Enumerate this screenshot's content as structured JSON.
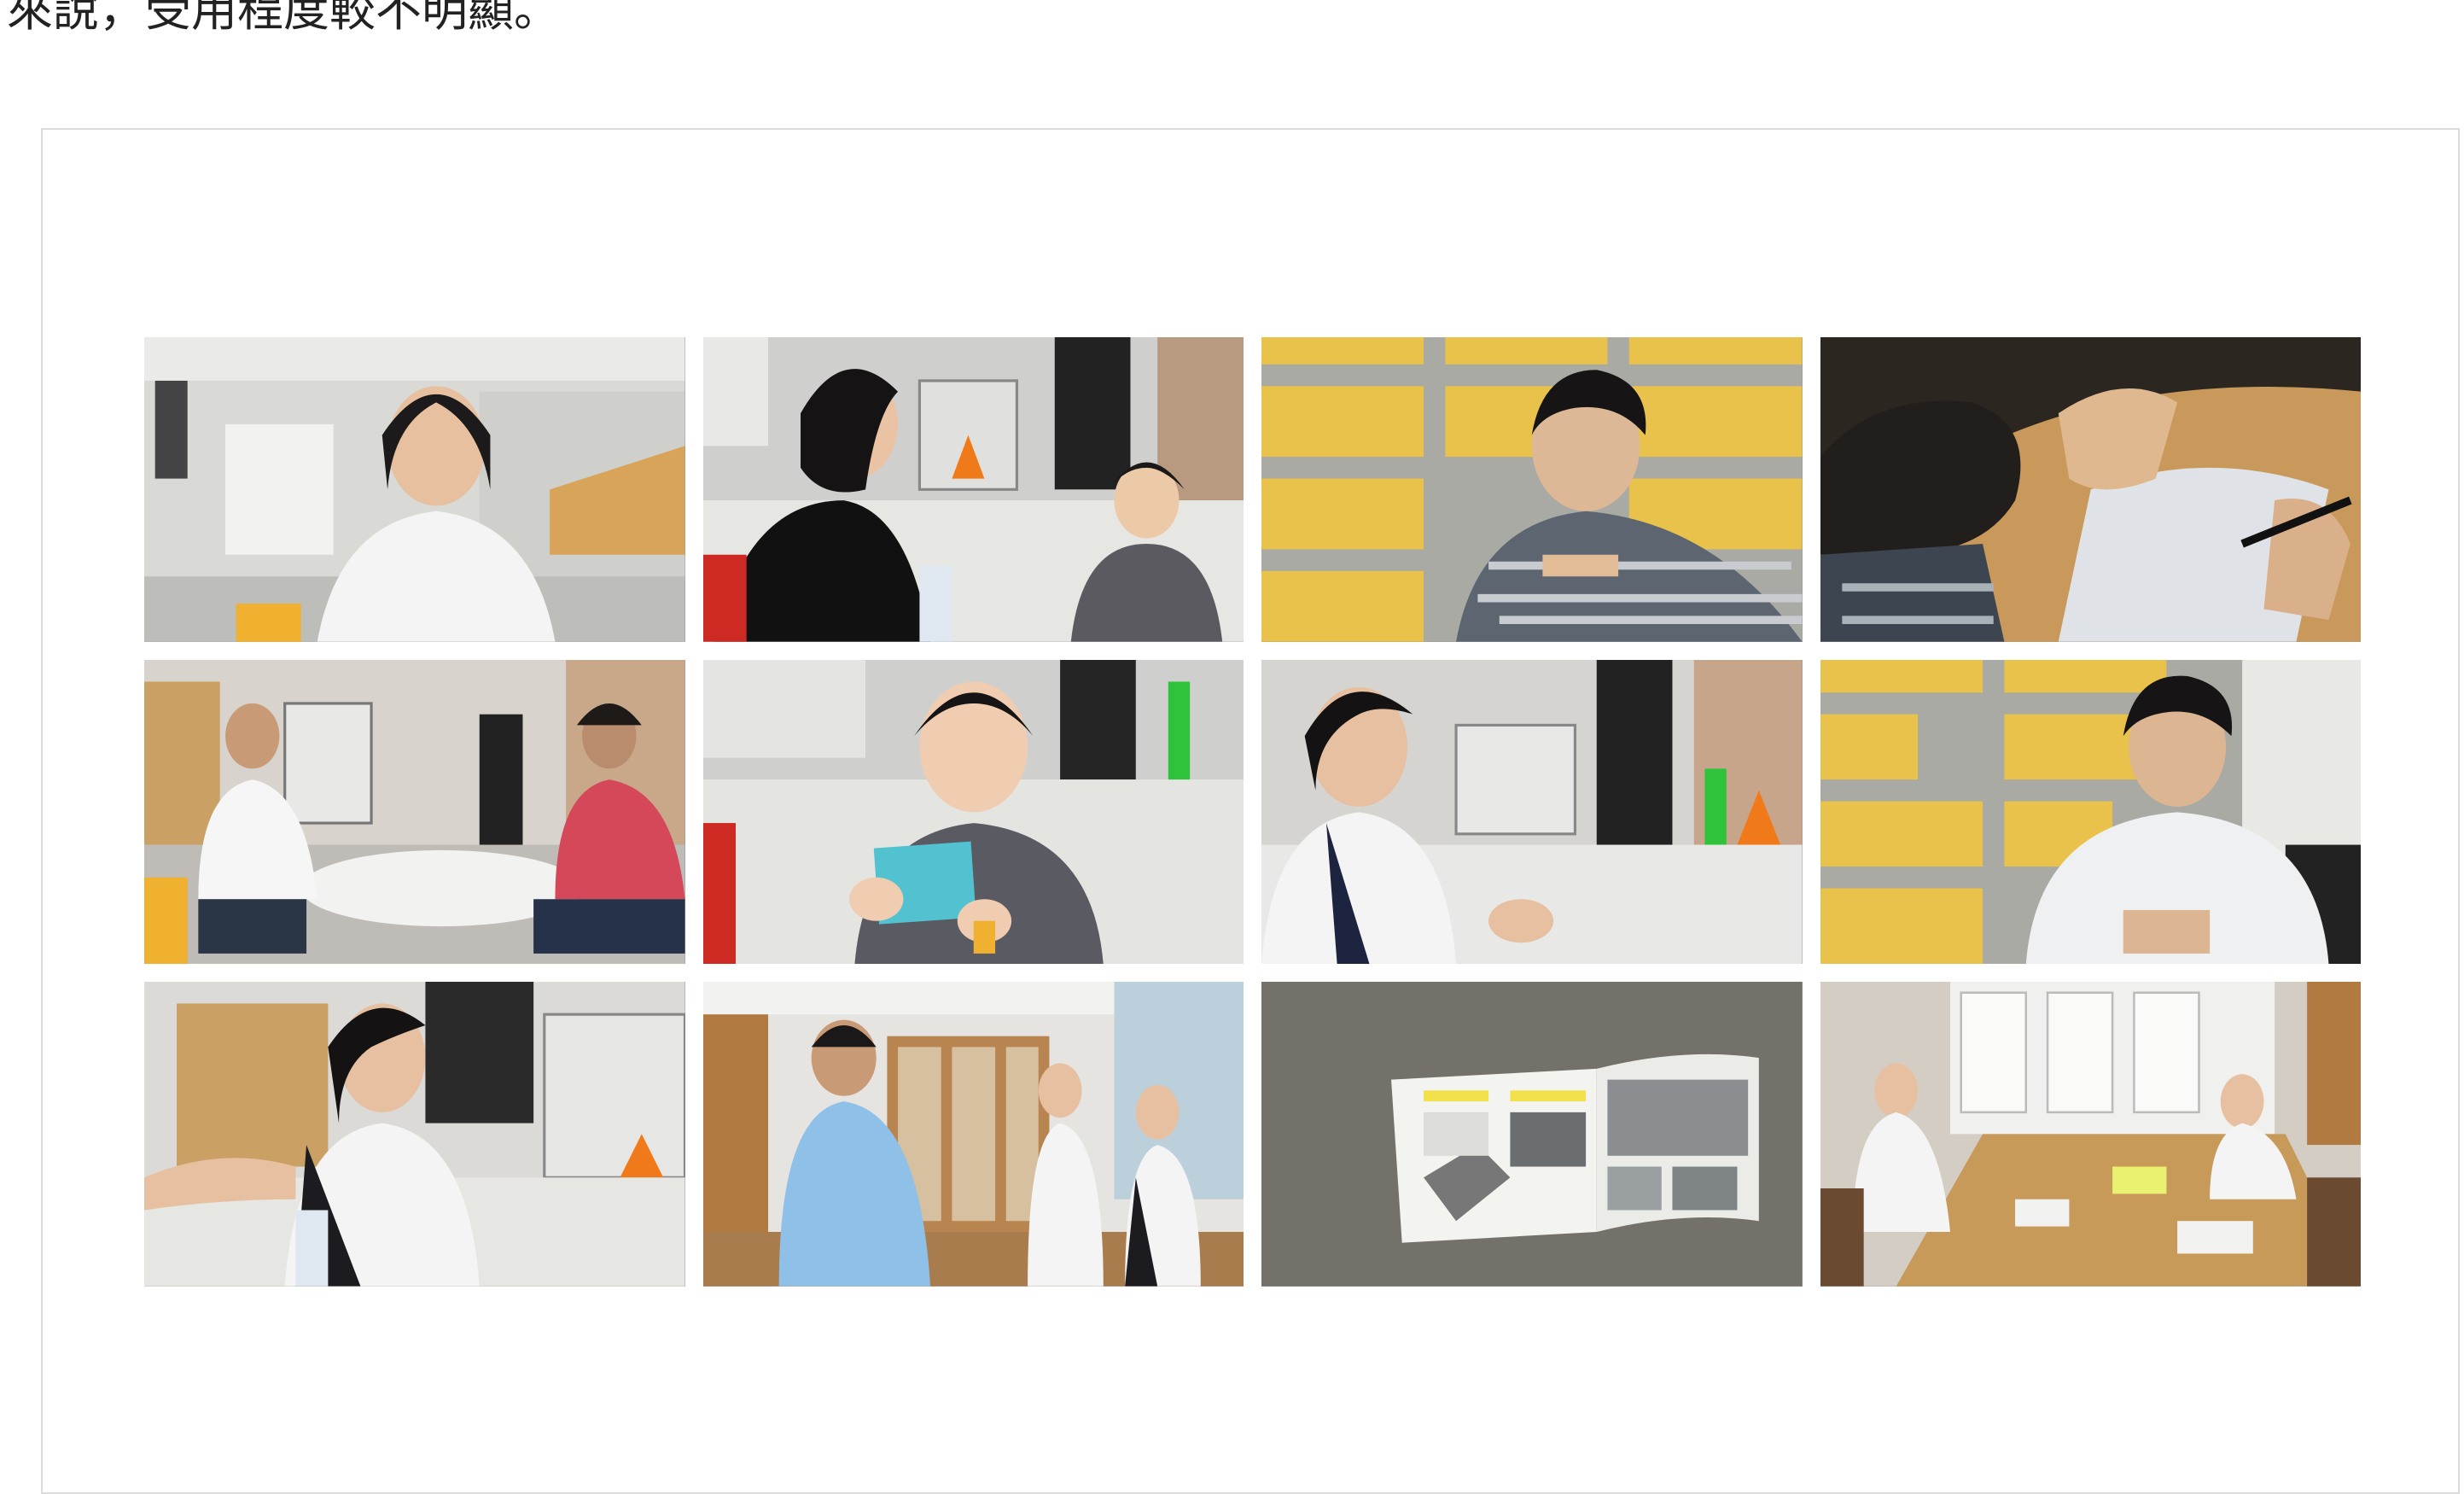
{
  "document": {
    "text_line": "來說，受用程度較不明顯。"
  },
  "photos": [
    {
      "name": "photo-woman-interview-office"
    },
    {
      "name": "photo-woman-and-girl-3d-printers"
    },
    {
      "name": "photo-young-man-writing-bookshelves"
    },
    {
      "name": "photo-hand-gesture-paper"
    },
    {
      "name": "photo-two-men-round-table"
    },
    {
      "name": "photo-girl-holding-card"
    },
    {
      "name": "photo-woman-3d-printer-lab"
    },
    {
      "name": "photo-man-interview-bookshelves"
    },
    {
      "name": "photo-woman-gesturing-lab"
    },
    {
      "name": "photo-people-standing-library"
    },
    {
      "name": "photo-open-booklet"
    },
    {
      "name": "photo-meeting-room-table"
    }
  ],
  "colors": {
    "frame_border": "#dcdcdc",
    "shelf_yellow": "#e8c24a",
    "printer_orange": "#f07a1a"
  }
}
